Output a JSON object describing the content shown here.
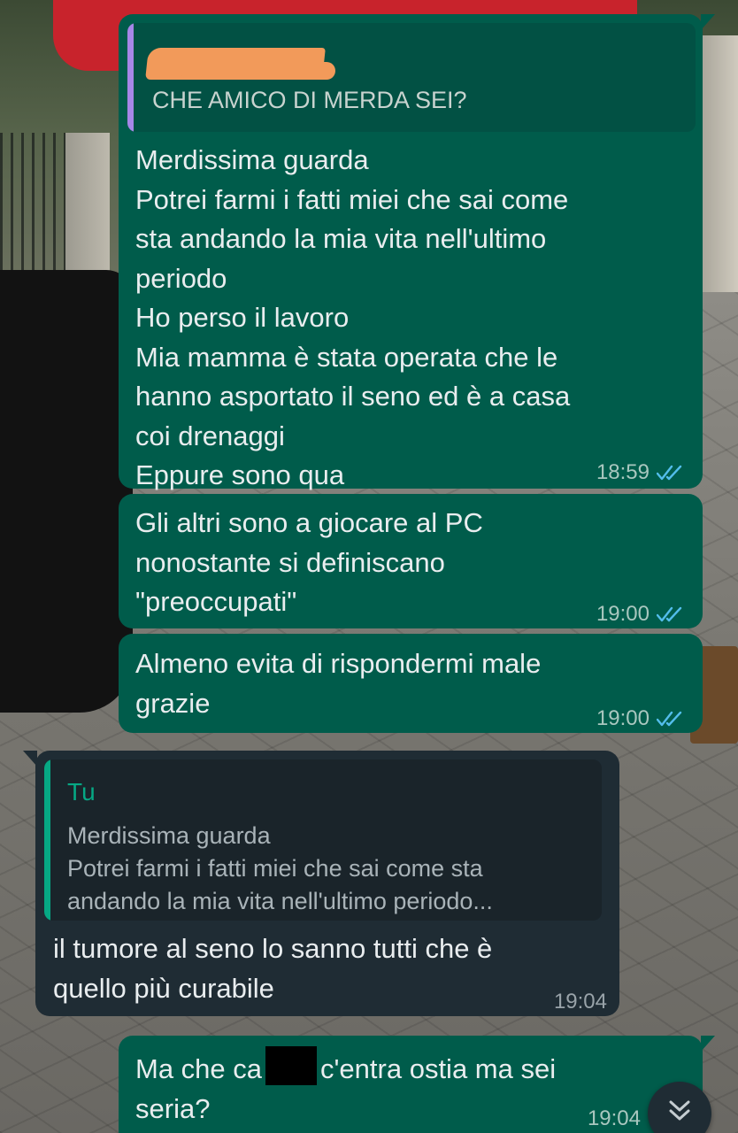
{
  "theme": {
    "outgoing_bubble": "#005c4b",
    "incoming_bubble": "#1f2c34",
    "read_tick_color": "#53bdeb",
    "reply_bar_purple": "#a687e8",
    "reply_bar_green": "#06a884"
  },
  "messages": [
    {
      "direction": "outgoing",
      "quote": {
        "text": "CHE AMICO DI MERDA SEI?",
        "author_redacted": true
      },
      "text": "Merdissima guarda\nPotrei farmi i fatti miei che sai come\nsta andando la mia vita nell'ultimo\nperiodo\nHo perso il lavoro\nMia mamma è stata operata che le\nhanno asportato il seno ed è a casa\ncoi drenaggi\nEppure sono qua",
      "time": "18:59",
      "status": "read"
    },
    {
      "direction": "outgoing",
      "text": "Gli altri sono a giocare al PC\nnonostante si definiscano\n\"preoccupati\"",
      "time": "19:00",
      "status": "read"
    },
    {
      "direction": "outgoing",
      "text": "Almeno evita di rispondermi male\ngrazie",
      "time": "19:00",
      "status": "read"
    },
    {
      "direction": "incoming",
      "quote": {
        "author": "Tu",
        "text": "Merdissima guarda\nPotrei farmi i fatti miei che sai come sta\nandando la mia vita nell'ultimo periodo..."
      },
      "text": "il tumore al seno lo sanno tutti che è\nquello più curabile",
      "time": "19:04"
    },
    {
      "direction": "outgoing",
      "text_before": "Ma che ca",
      "text_after": "c'entra ostia ma sei",
      "text_line2": "seria?",
      "time": "19:04",
      "status": "read"
    }
  ],
  "scroll_button": {
    "icon": "double-chevron-down-icon"
  }
}
